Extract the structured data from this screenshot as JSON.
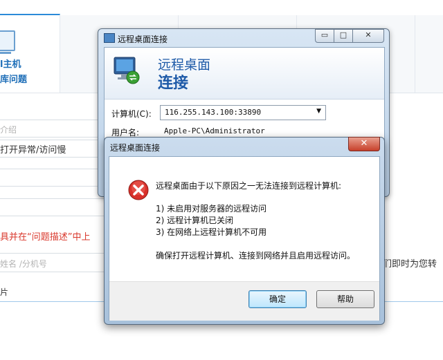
{
  "background": {
    "tab": {
      "title_partial": "l主机",
      "subtitle_partial": "库问题"
    },
    "fields": {
      "intro_placeholder_partial": "介绍",
      "issue_text_partial": "打开异常/访问慢",
      "warning_text_partial": "具并在“问题描述”中上",
      "contact_placeholder_partial": "姓名 /分机号",
      "right_notice_partial": "们即时为您转",
      "bottom_partial": "片"
    },
    "colors": {
      "link_blue": "#1f6fb8",
      "warning_red": "#d9372b"
    }
  },
  "rdp_window": {
    "title": "远程桌面连接",
    "banner_line1": "远程桌面",
    "banner_line2": "连接",
    "computer_label": "计算机(C):",
    "computer_value": "116.255.143.100:33890",
    "username_label": "用户名:",
    "username_value": "Apple-PC\\Administrator",
    "controls": {
      "minimize": "▭",
      "maximize": "□",
      "close": "✕"
    }
  },
  "error_dialog": {
    "title": "远程桌面连接",
    "close_label": "✕",
    "message": "远程桌面由于以下原因之一无法连接到远程计算机:",
    "reasons": [
      "1) 未启用对服务器的远程访问",
      "2) 远程计算机已关闭",
      "3) 在网络上远程计算机不可用"
    ],
    "advice": "确保打开远程计算机、连接到网络并且启用远程访问。",
    "ok_label": "确定",
    "help_label": "帮助",
    "icon": "error-icon"
  }
}
